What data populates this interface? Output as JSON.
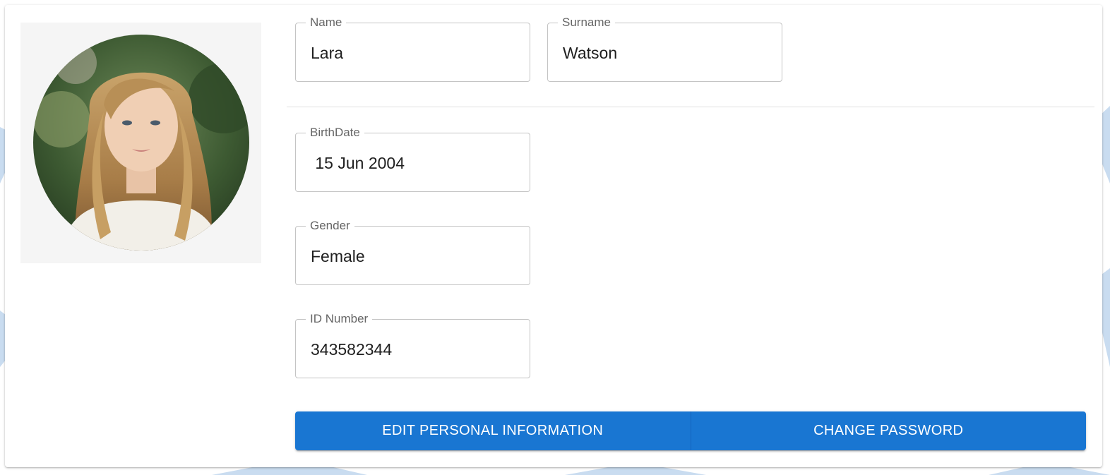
{
  "profile": {
    "avatar_alt": "profile-photo",
    "fields": {
      "name": {
        "label": "Name",
        "value": "Lara"
      },
      "surname": {
        "label": "Surname",
        "value": "Watson"
      },
      "birthdate": {
        "label": "BirthDate",
        "value": " 15 Jun 2004"
      },
      "gender": {
        "label": "Gender",
        "value": "Female"
      },
      "id_number": {
        "label": "ID Number",
        "value": "343582344"
      }
    }
  },
  "actions": {
    "edit_label": "EDIT PERSONAL INFORMATION",
    "change_password_label": "CHANGE PASSWORD"
  },
  "colors": {
    "primary": "#1976d2",
    "border": "#c4c4c4",
    "label": "#666666"
  }
}
